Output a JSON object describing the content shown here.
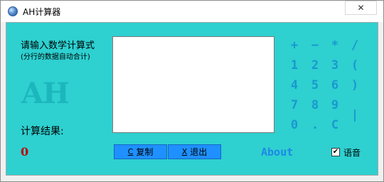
{
  "window": {
    "title": "AH计算器",
    "close_glyph": "✕"
  },
  "input": {
    "prompt": "请输入数学计算式",
    "sub_prompt": "(分行的数据自动合计)",
    "value": "",
    "placeholder": ""
  },
  "logo_text": "AH",
  "result": {
    "label": "计算结果:",
    "value": "0"
  },
  "buttons": {
    "copy": {
      "mnemonic": "C",
      "label": "复制"
    },
    "exit": {
      "mnemonic": "X",
      "label": "退出"
    }
  },
  "keypad": {
    "keys": [
      "+",
      "−",
      "*",
      "/",
      "1",
      "2",
      "3",
      "(",
      "4",
      "5",
      "6",
      ")",
      "7",
      "8",
      "9",
      "|",
      "0",
      ".",
      "C",
      ""
    ]
  },
  "about_label": "About",
  "voice": {
    "label": "语音",
    "checked": true,
    "check_glyph": "✔"
  },
  "colors": {
    "panel_bg": "#2ed0d0",
    "key_text": "#1a98d0",
    "button_bg": "#1e90ff",
    "result_value": "#c00000",
    "logo": "#1cb7bd"
  }
}
